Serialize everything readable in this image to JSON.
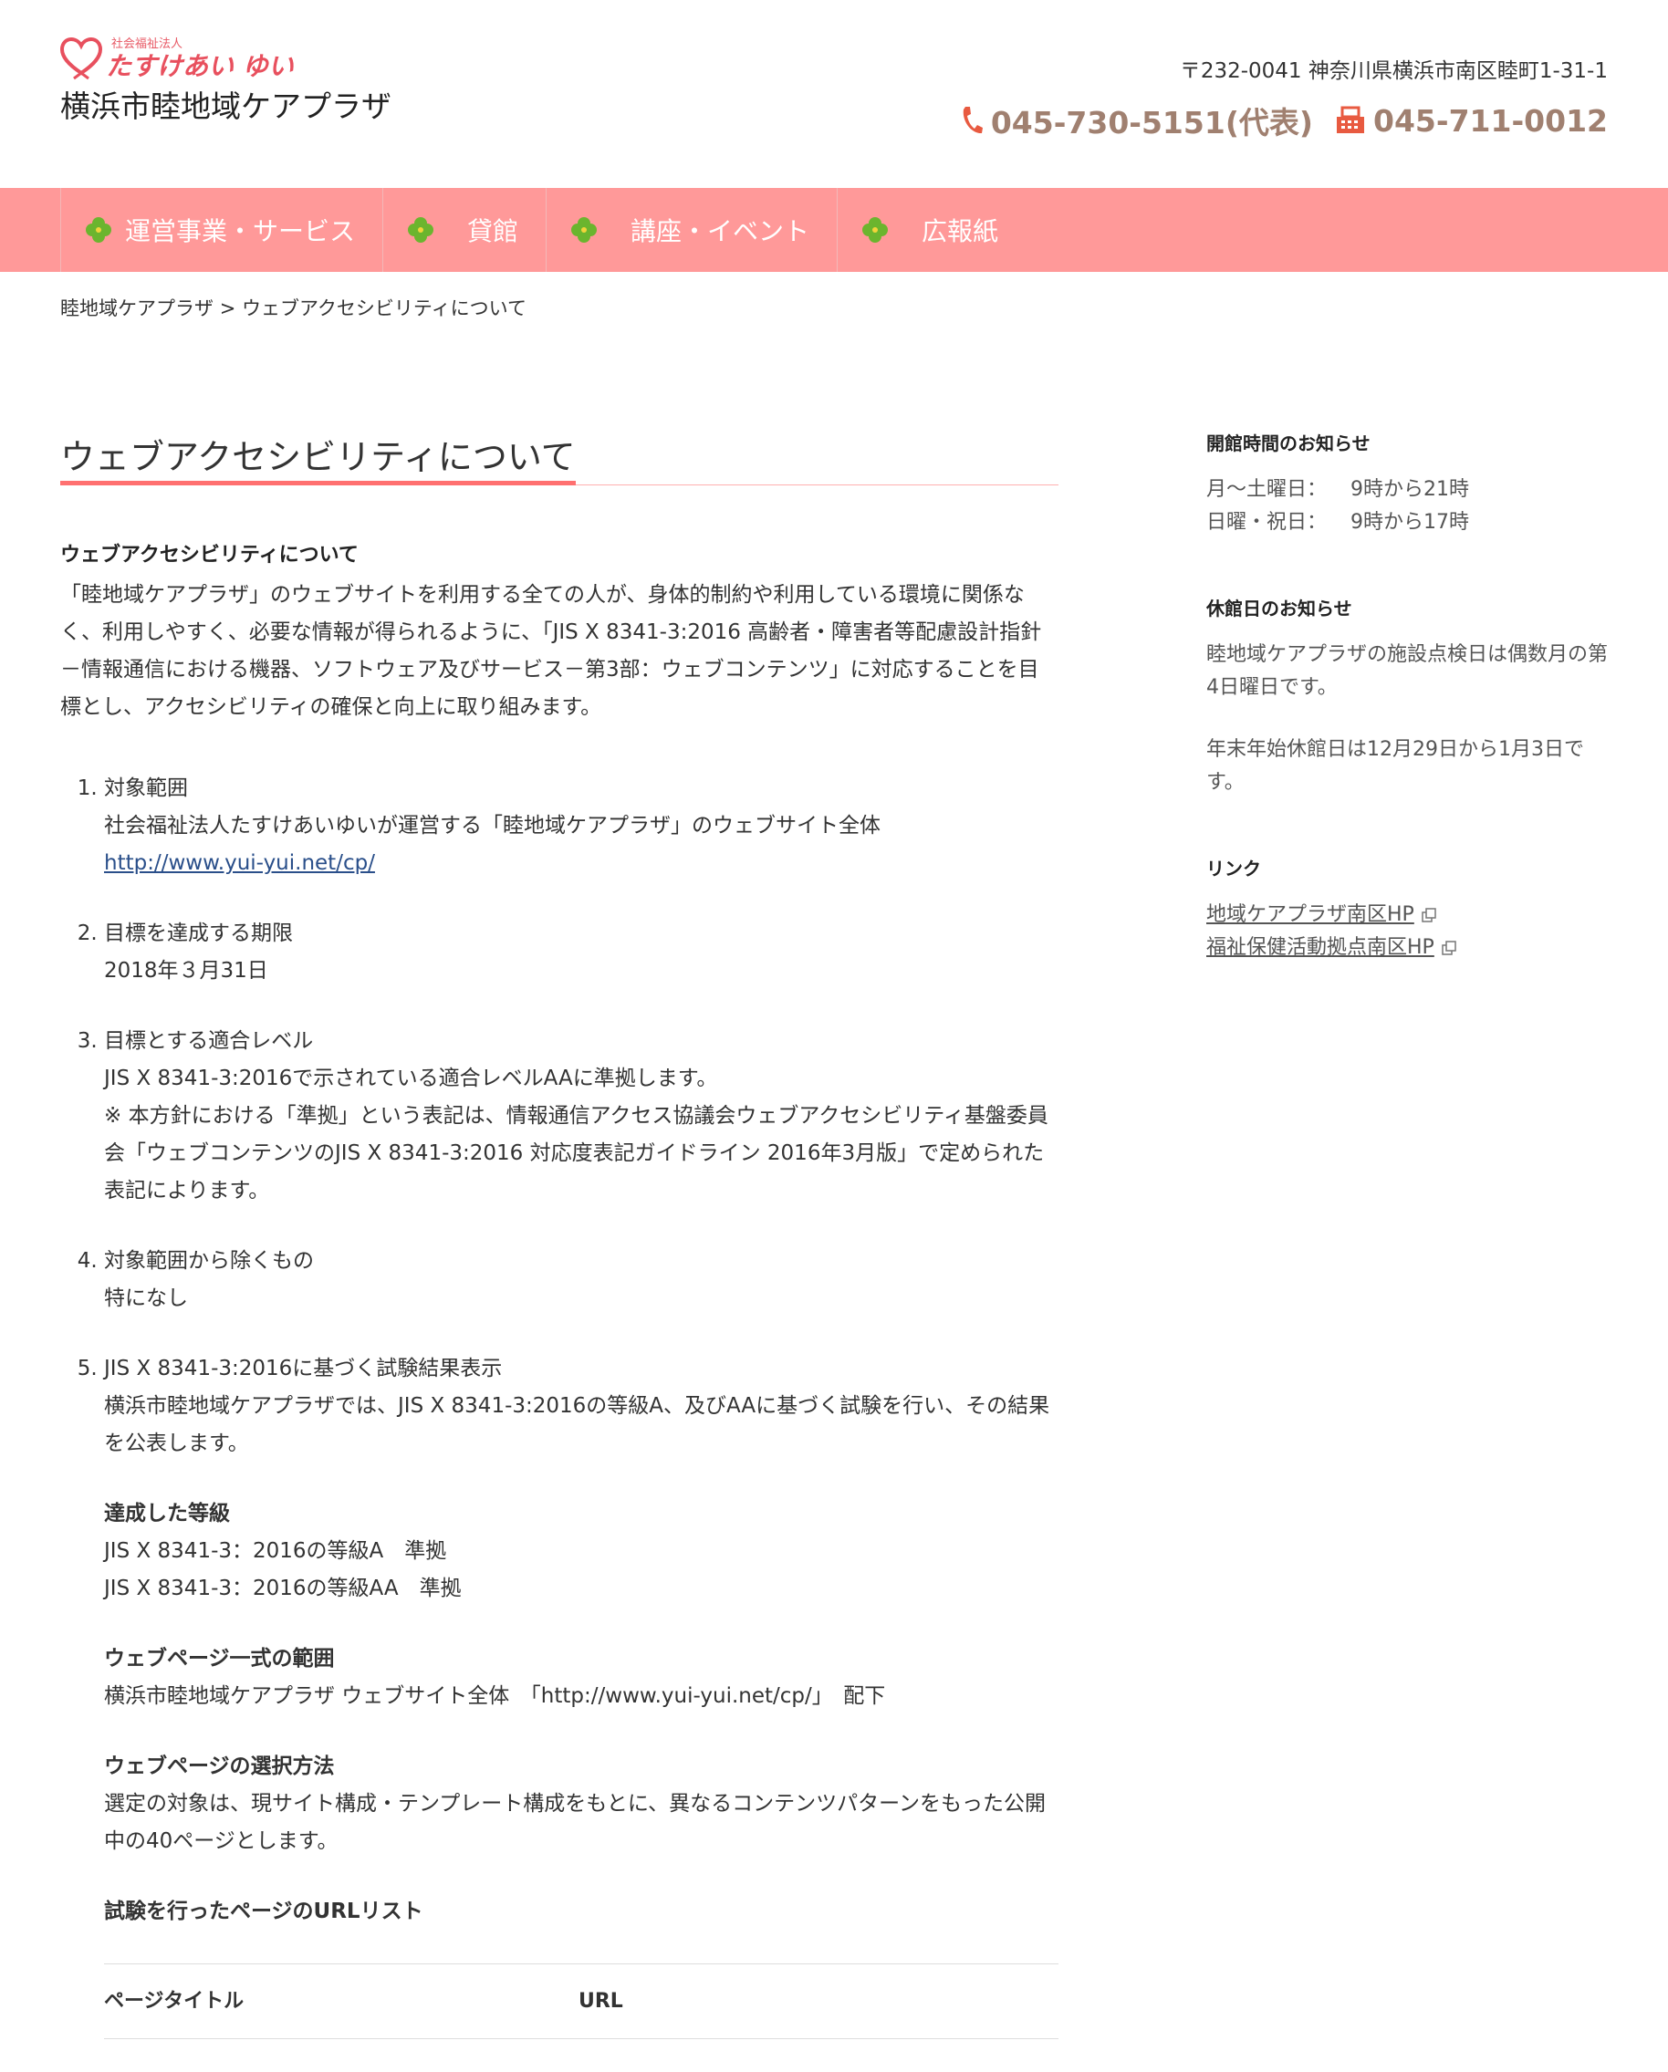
{
  "header": {
    "logo_small": "社会福祉法人",
    "logo_brand": "たすけあい ゆい",
    "site_name": "横浜市睦地域ケアプラザ",
    "address": "〒232-0041 神奈川県横浜市南区睦町1-31-1",
    "phone": "045-730-5151(代表)",
    "fax": "045-711-0012"
  },
  "nav": {
    "items": [
      {
        "label": "運営事業・サービス"
      },
      {
        "label": "貸館"
      },
      {
        "label": "講座・イベント"
      },
      {
        "label": "広報紙"
      }
    ]
  },
  "breadcrumb": {
    "home": "睦地域ケアプラザ",
    "sep": ">",
    "current": "ウェブアクセシビリティについて"
  },
  "main": {
    "title": "ウェブアクセシビリティについて",
    "section_heading": "ウェブアクセシビリティについて",
    "intro": "「睦地域ケアプラザ」のウェブサイトを利用する全ての人が、身体的制約や利用している環境に関係なく、利用しやすく、必要な情報が得られるように、「JIS X 8341-3:2016 高齢者・障害者等配慮設計指針－情報通信における機器、ソフトウェア及びサービス－第3部：ウェブコンテンツ」に対応することを目標とし、アクセシビリティの確保と向上に取り組みます。",
    "items": [
      {
        "title": "対象範囲",
        "text": "社会福祉法人たすけあいゆいが運営する「睦地域ケアプラザ」のウェブサイト全体",
        "link": "http://www.yui-yui.net/cp/"
      },
      {
        "title": "目標を達成する期限",
        "text": "2018年３月31日"
      },
      {
        "title": "目標とする適合レベル",
        "text": "JIS X 8341-3:2016で示されている適合レベルAAに準拠します。",
        "note": "※ 本方針における「準拠」という表記は、情報通信アクセス協議会ウェブアクセシビリティ基盤委員会「ウェブコンテンツのJIS X 8341-3:2016 対応度表記ガイドライン 2016年3月版」で定められた表記によります。"
      },
      {
        "title": "対象範囲から除くもの",
        "text": "特になし"
      },
      {
        "title": "JIS X 8341-3:2016に基づく試験結果表示",
        "text": "横浜市睦地域ケアプラザでは、JIS X 8341-3:2016の等級A、及びAAに基づく試験を行い、その結果を公表します。"
      }
    ],
    "grade_heading": "達成した等級",
    "grade_a": "JIS X 8341-3：2016の等級A　準拠",
    "grade_aa": "JIS X 8341-3：2016の等級AA　準拠",
    "scope_heading": "ウェブページ一式の範囲",
    "scope_text": "横浜市睦地域ケアプラザ ウェブサイト全体　「http://www.yui-yui.net/cp/」　配下",
    "method_heading": "ウェブページの選択方法",
    "method_text": "選定の対象は、現サイト構成・テンプレート構成をもとに、異なるコンテンツパターンをもった公開中の40ページとします。",
    "urllist_heading": "試験を行ったページのURLリスト",
    "table_headers": [
      "ページタイトル",
      "URL"
    ]
  },
  "sidebar": {
    "hours_heading": "開館時間のお知らせ",
    "hours": [
      {
        "day": "月～土曜日：",
        "time": "9時から21時"
      },
      {
        "day": "日曜・祝日：",
        "time": "9時から17時"
      }
    ],
    "holiday_heading": "休館日のお知らせ",
    "holiday_text1": "睦地域ケアプラザの施設点検日は偶数月の第4日曜日です。",
    "holiday_text2": "年末年始休館日は12月29日から1月3日です。",
    "links_heading": "リンク",
    "links": [
      {
        "label": "地域ケアプラザ南区HP"
      },
      {
        "label": "福祉保健活動拠点南区HP"
      }
    ]
  },
  "colors": {
    "nav_bg": "#ff9999",
    "accent": "#ff7070",
    "phone": "#a08070",
    "link": "#2a4f8a"
  }
}
